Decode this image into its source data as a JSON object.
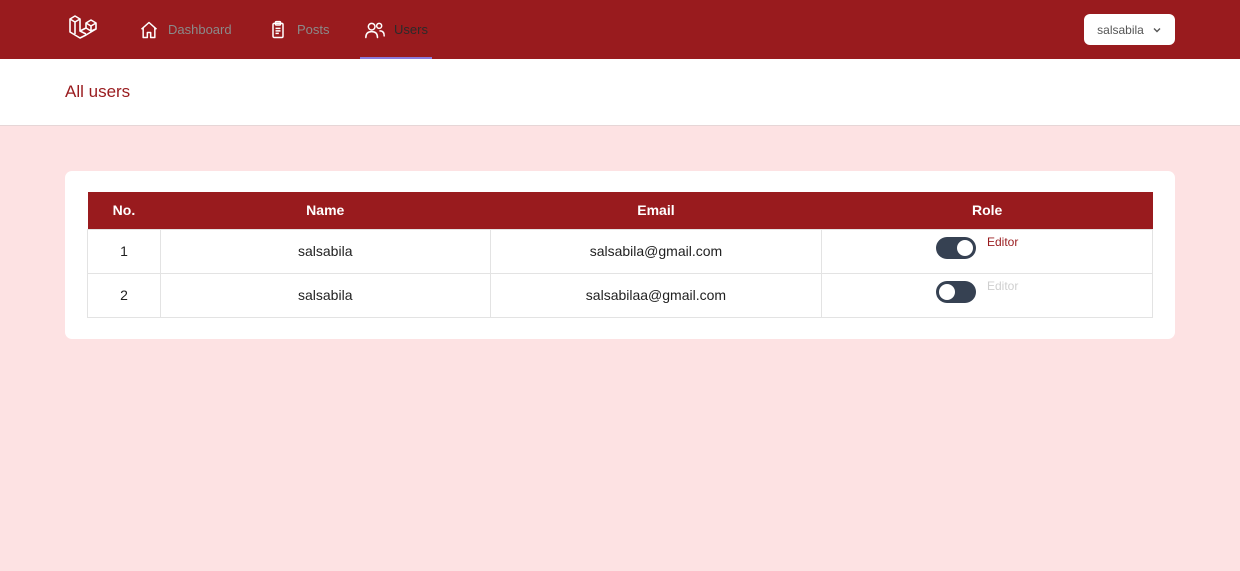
{
  "nav": {
    "items": [
      {
        "label": "Dashboard",
        "icon": "home-icon"
      },
      {
        "label": "Posts",
        "icon": "clipboard-icon"
      },
      {
        "label": "Users",
        "icon": "users-icon",
        "active": true
      }
    ],
    "user_menu": {
      "label": "salsabila",
      "icon": "chevron-down-icon"
    }
  },
  "header": {
    "title": "All users"
  },
  "table": {
    "columns": [
      "No.",
      "Name",
      "Email",
      "Role"
    ],
    "rows": [
      {
        "no": "1",
        "name": "salsabila",
        "email": "salsabila@gmail.com",
        "role": "Editor",
        "role_enabled": true
      },
      {
        "no": "2",
        "name": "salsabila",
        "email": "salsabilaa@gmail.com",
        "role": "Editor",
        "role_enabled": false
      }
    ]
  },
  "colors": {
    "brand": "#991b1e",
    "page_background": "#fde2e3",
    "toggle_track": "#364152",
    "active_tab_indicator": "#8b7bdc"
  }
}
